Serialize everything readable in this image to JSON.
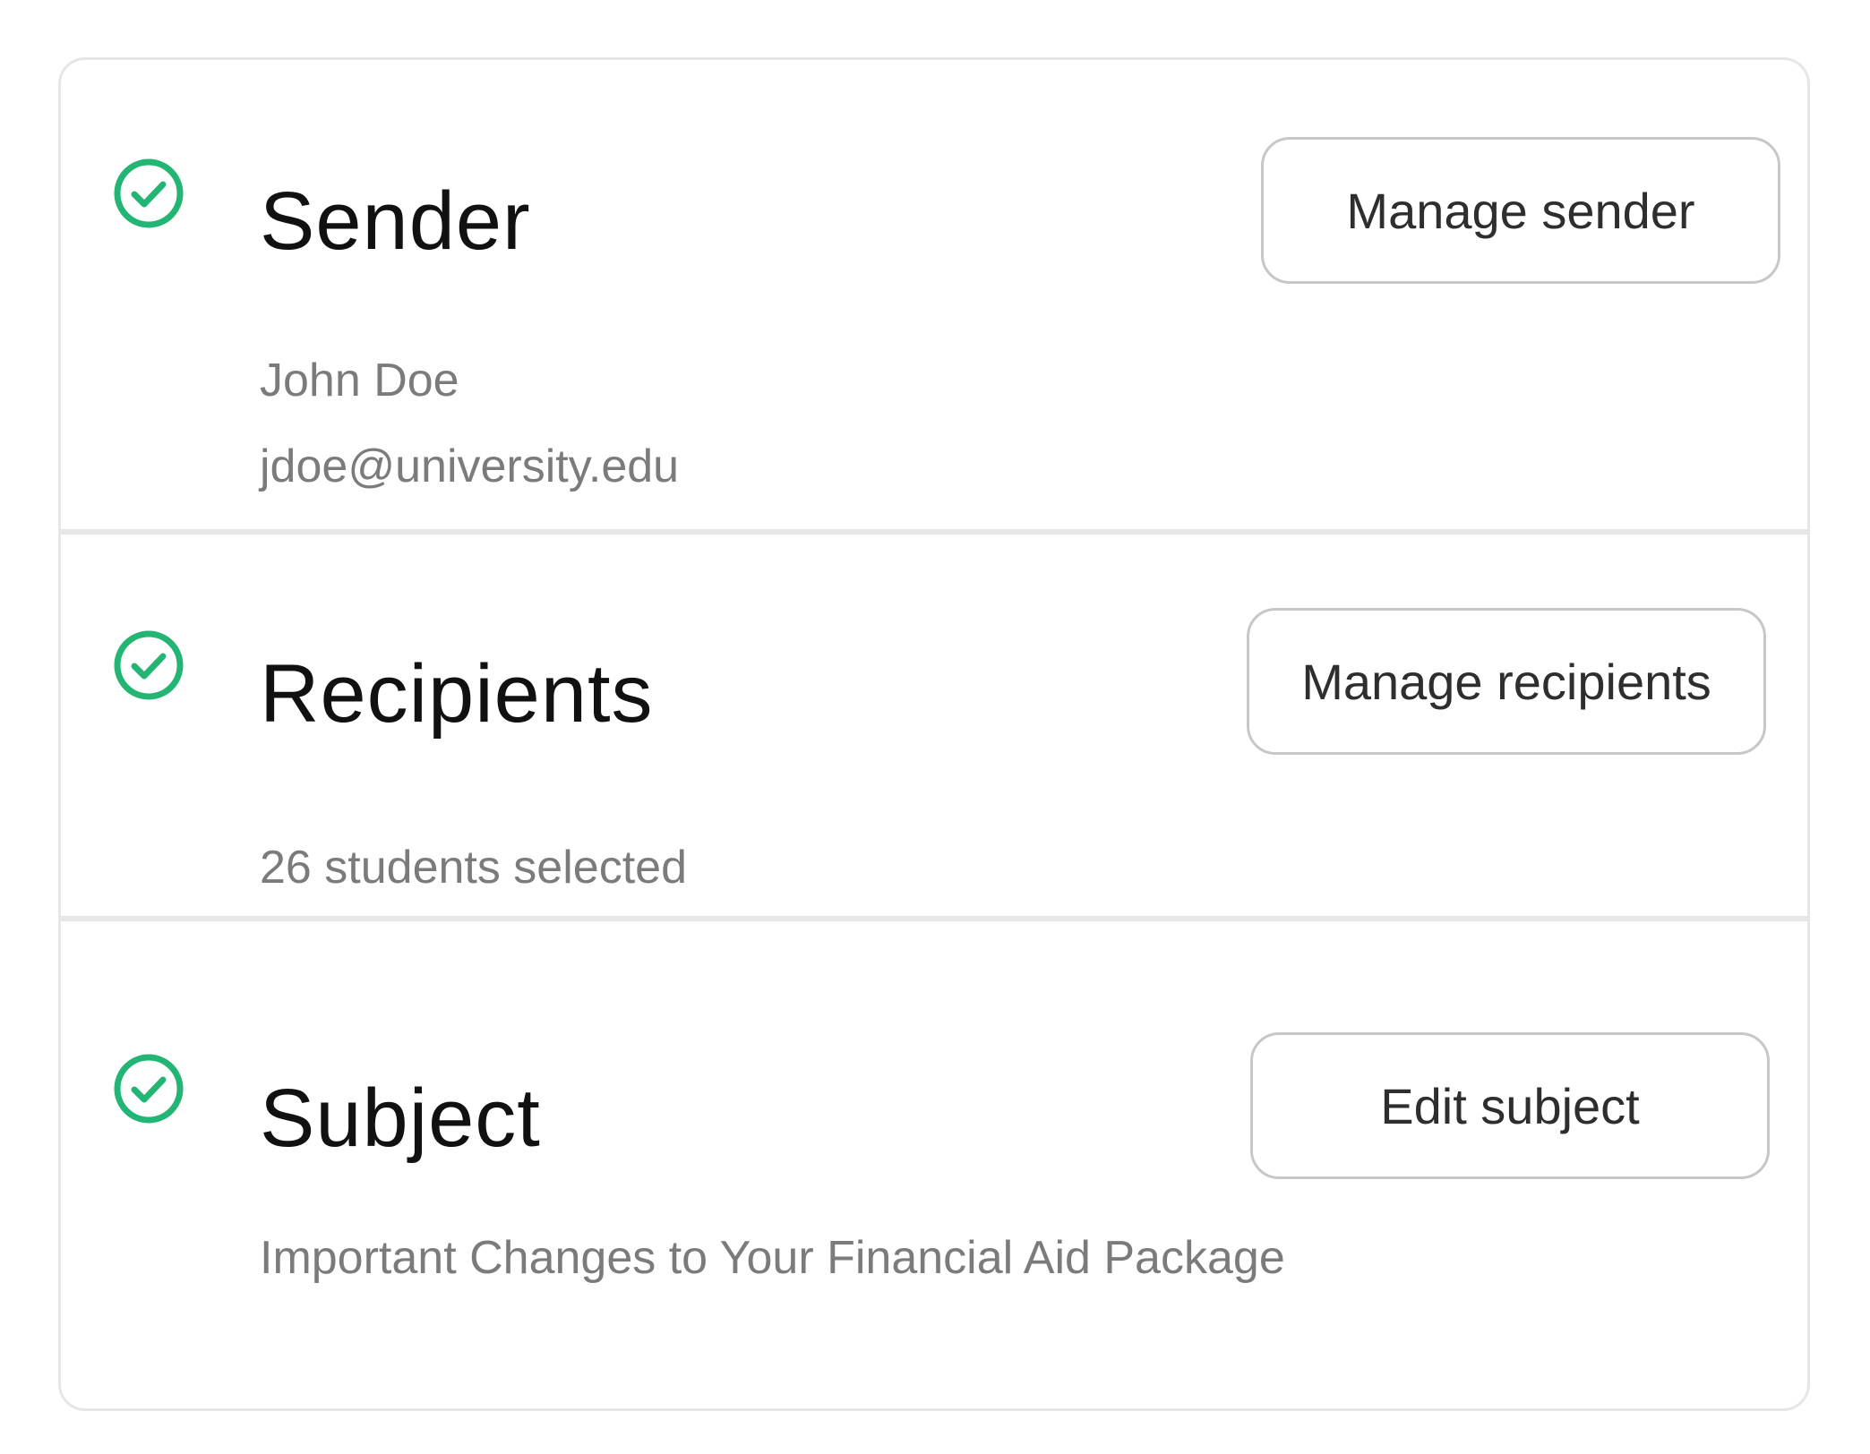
{
  "colors": {
    "check_green": "#22b573",
    "title_text": "#111111",
    "secondary_text": "#7b7b7b",
    "button_border": "#c7c7c7",
    "divider": "#e6e6e6"
  },
  "sections": [
    {
      "status_icon": "check-circle-icon",
      "title": "Sender",
      "lines": [
        "John Doe",
        "jdoe@university.edu"
      ],
      "button_label": "Manage sender"
    },
    {
      "status_icon": "check-circle-icon",
      "title": "Recipients",
      "lines": [
        "26 students selected"
      ],
      "button_label": "Manage recipients"
    },
    {
      "status_icon": "check-circle-icon",
      "title": "Subject",
      "lines": [
        "Important Changes to Your Financial Aid Package"
      ],
      "button_label": "Edit subject"
    }
  ]
}
